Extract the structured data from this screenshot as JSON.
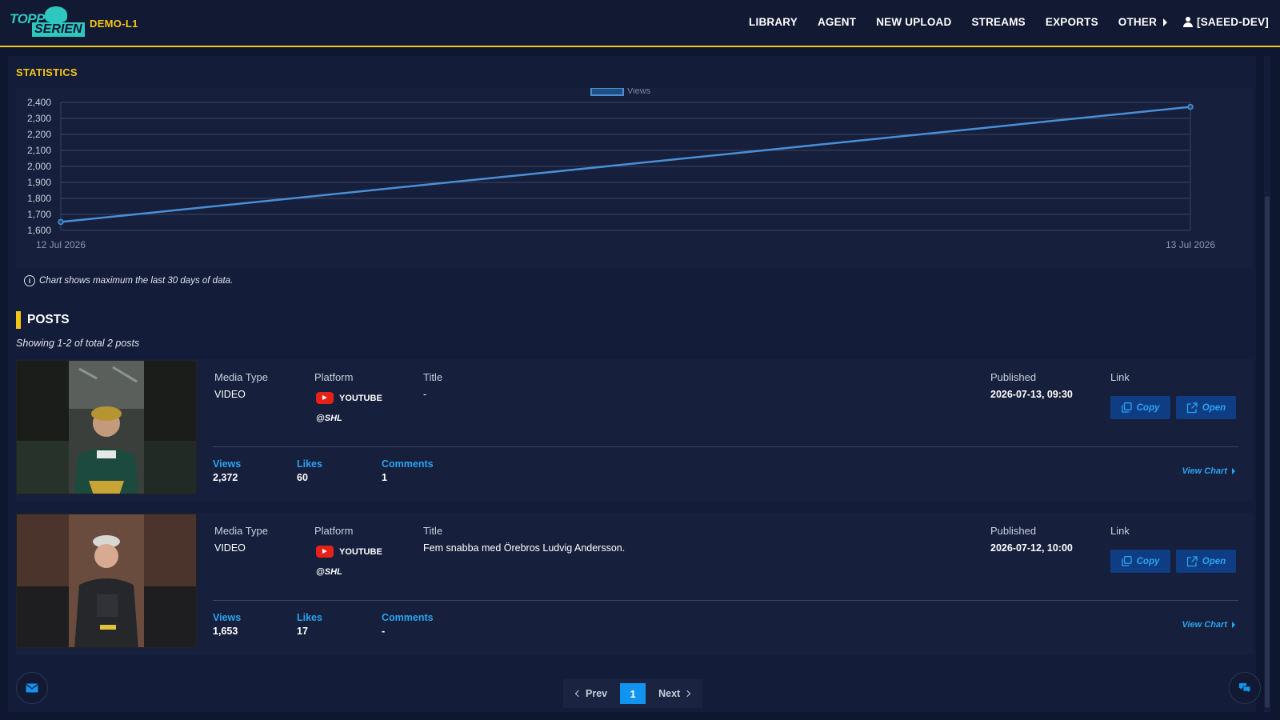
{
  "header": {
    "logo_top": "TOPP",
    "logo_bottom": "SERIEN",
    "site_name": "DEMO-L1",
    "nav": [
      "LIBRARY",
      "AGENT",
      "NEW UPLOAD",
      "STREAMS",
      "EXPORTS",
      "OTHER"
    ],
    "user": "[SAEED-DEV]"
  },
  "statistics": {
    "title": "STATISTICS",
    "note": "Chart shows maximum the last 30 days of data."
  },
  "chart_data": {
    "type": "line",
    "title": "",
    "xlabel": "",
    "ylabel": "",
    "x": [
      "12 Jul 2026",
      "13 Jul 2026"
    ],
    "series": [
      {
        "name": "Views",
        "values": [
          1653,
          2372
        ]
      }
    ],
    "y_ticks": [
      "1,600",
      "1,700",
      "1,800",
      "1,900",
      "2,000",
      "2,100",
      "2,200",
      "2,300",
      "2,400"
    ],
    "ylim": [
      1600,
      2400
    ],
    "grid": true,
    "legend": "top-center",
    "color": "#4a8fd6"
  },
  "posts": {
    "title": "POSTS",
    "showing": "Showing 1-2 of total 2 posts",
    "labels": {
      "media_type": "Media Type",
      "platform": "Platform",
      "title": "Title",
      "published": "Published",
      "link": "Link",
      "views": "Views",
      "likes": "Likes",
      "comments": "Comments",
      "copy": "Copy",
      "open": "Open",
      "view_chart": "View Chart"
    },
    "items": [
      {
        "media_type": "VIDEO",
        "platform": "YOUTUBE",
        "handle": "@SHL",
        "title": "-",
        "published": "2026-07-13, 09:30",
        "views": "2,372",
        "likes": "60",
        "comments": "1"
      },
      {
        "media_type": "VIDEO",
        "platform": "YOUTUBE",
        "handle": "@SHL",
        "title": "Fem snabba med Örebros Ludvig Andersson.",
        "published": "2026-07-12, 10:00",
        "views": "1,653",
        "likes": "17",
        "comments": "-"
      }
    ]
  },
  "pagination": {
    "prev": "Prev",
    "current": "1",
    "next": "Next"
  }
}
